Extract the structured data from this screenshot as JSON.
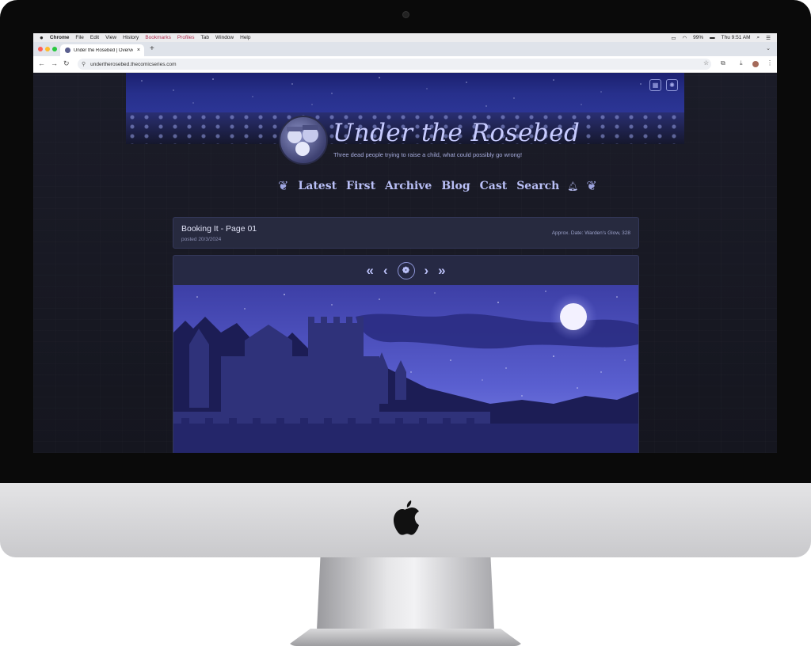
{
  "menubar": {
    "apple": "",
    "items": [
      "Chrome",
      "File",
      "Edit",
      "View",
      "History",
      "Bookmarks",
      "Profiles",
      "Tab",
      "Window",
      "Help"
    ],
    "battery": "99%",
    "clock": "Thu 9:51 AM"
  },
  "browser": {
    "tab_title": "Under the Rosebed | Overvie",
    "tab_close": "×",
    "new_tab": "+",
    "url": "undertherosebed.thecomicseries.com"
  },
  "site": {
    "title": "Under the Rosebed",
    "tagline": "Three dead people trying to raise a child, what could possibly go wrong!",
    "nav": [
      "Latest",
      "First",
      "Archive",
      "Blog",
      "Cast",
      "Search"
    ],
    "page_title": "Booking It - Page 01",
    "posted": "posted 20/3/2024",
    "approx_date": "Approx. Date: Warden's Glow, 328"
  },
  "pager": {
    "first": "«",
    "prev": "‹",
    "next": "›",
    "last": "»"
  },
  "colors": {
    "accent": "#b9bff6",
    "page_bg": "#191a24",
    "panel": "#272a3f"
  },
  "icons": [
    "apple-icon",
    "wifi-icon",
    "battery-icon",
    "search-icon",
    "control-center-icon",
    "calendar-icon",
    "settings-icon",
    "bell-icon",
    "bookmark-star-icon",
    "extensions-icon",
    "download-icon",
    "profile-icon",
    "menu-icon"
  ]
}
